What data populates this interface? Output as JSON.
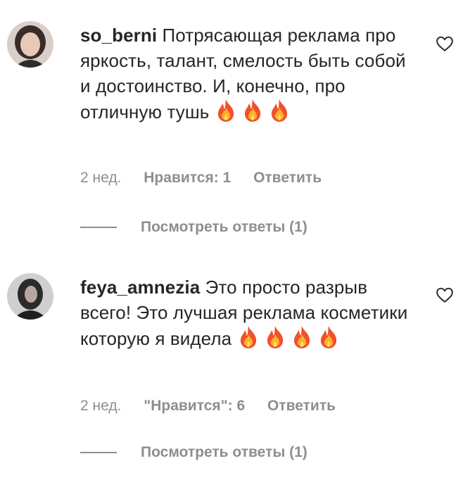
{
  "comments": [
    {
      "username": "so_berni",
      "text": "Потрясающая реклама про яркость, талант, смелость быть собой и достоинство. И, конечно, про отличную тушь",
      "emoji_count": 3,
      "time": "2 нед.",
      "likes": "Нравится: 1",
      "reply": "Ответить",
      "view_replies": "Посмотреть ответы (1)"
    },
    {
      "username": "feya_amnezia",
      "text": "Это просто разрыв всего! Это лучшая реклама косметики которую я видела",
      "emoji_count": 4,
      "time": "2 нед.",
      "likes": "\"Нравится\": 6",
      "reply": "Ответить",
      "view_replies": "Посмотреть ответы (1)"
    }
  ],
  "colors": {
    "text": "#262626",
    "muted": "#8e8e8e"
  },
  "icons": {
    "like": "heart-outline-icon",
    "emoji": "fire-emoji-icon"
  }
}
